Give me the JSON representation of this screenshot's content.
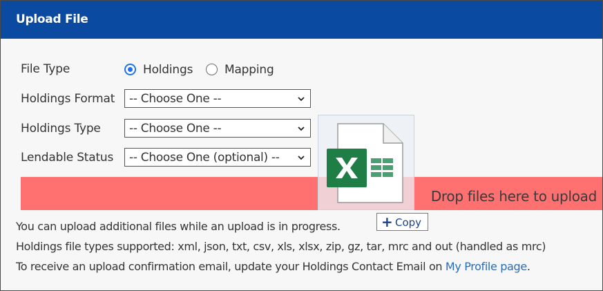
{
  "header": {
    "title": "Upload File"
  },
  "form": {
    "file_type": {
      "label": "File Type",
      "options": [
        {
          "label": "Holdings",
          "checked": true
        },
        {
          "label": "Mapping",
          "checked": false
        }
      ]
    },
    "holdings_format": {
      "label": "Holdings Format",
      "value": "-- Choose One --"
    },
    "holdings_type": {
      "label": "Holdings Type",
      "value": "-- Choose One --"
    },
    "lendable_status": {
      "label": "Lendable Status",
      "value": "-- Choose One (optional) --"
    }
  },
  "dropzone": {
    "text": "Drop files here to upload",
    "color": "#ff7070"
  },
  "drag": {
    "icon": "excel-file-icon",
    "copy_label": "Copy"
  },
  "info": {
    "line1": "You can upload additional files while an upload is in progress.",
    "line2": "Holdings file types supported: xml, json, txt, csv, xls, xlsx, zip, gz, tar, mrc and out (handled as mrc)",
    "line3_prefix": "To receive an upload confirmation email, update your Holdings Contact Email on ",
    "line3_link": "My Profile page",
    "line3_suffix": "."
  },
  "colors": {
    "header": "#0a4aa0",
    "link": "#2a6bb8",
    "radio_checked": "#1a73e8"
  }
}
